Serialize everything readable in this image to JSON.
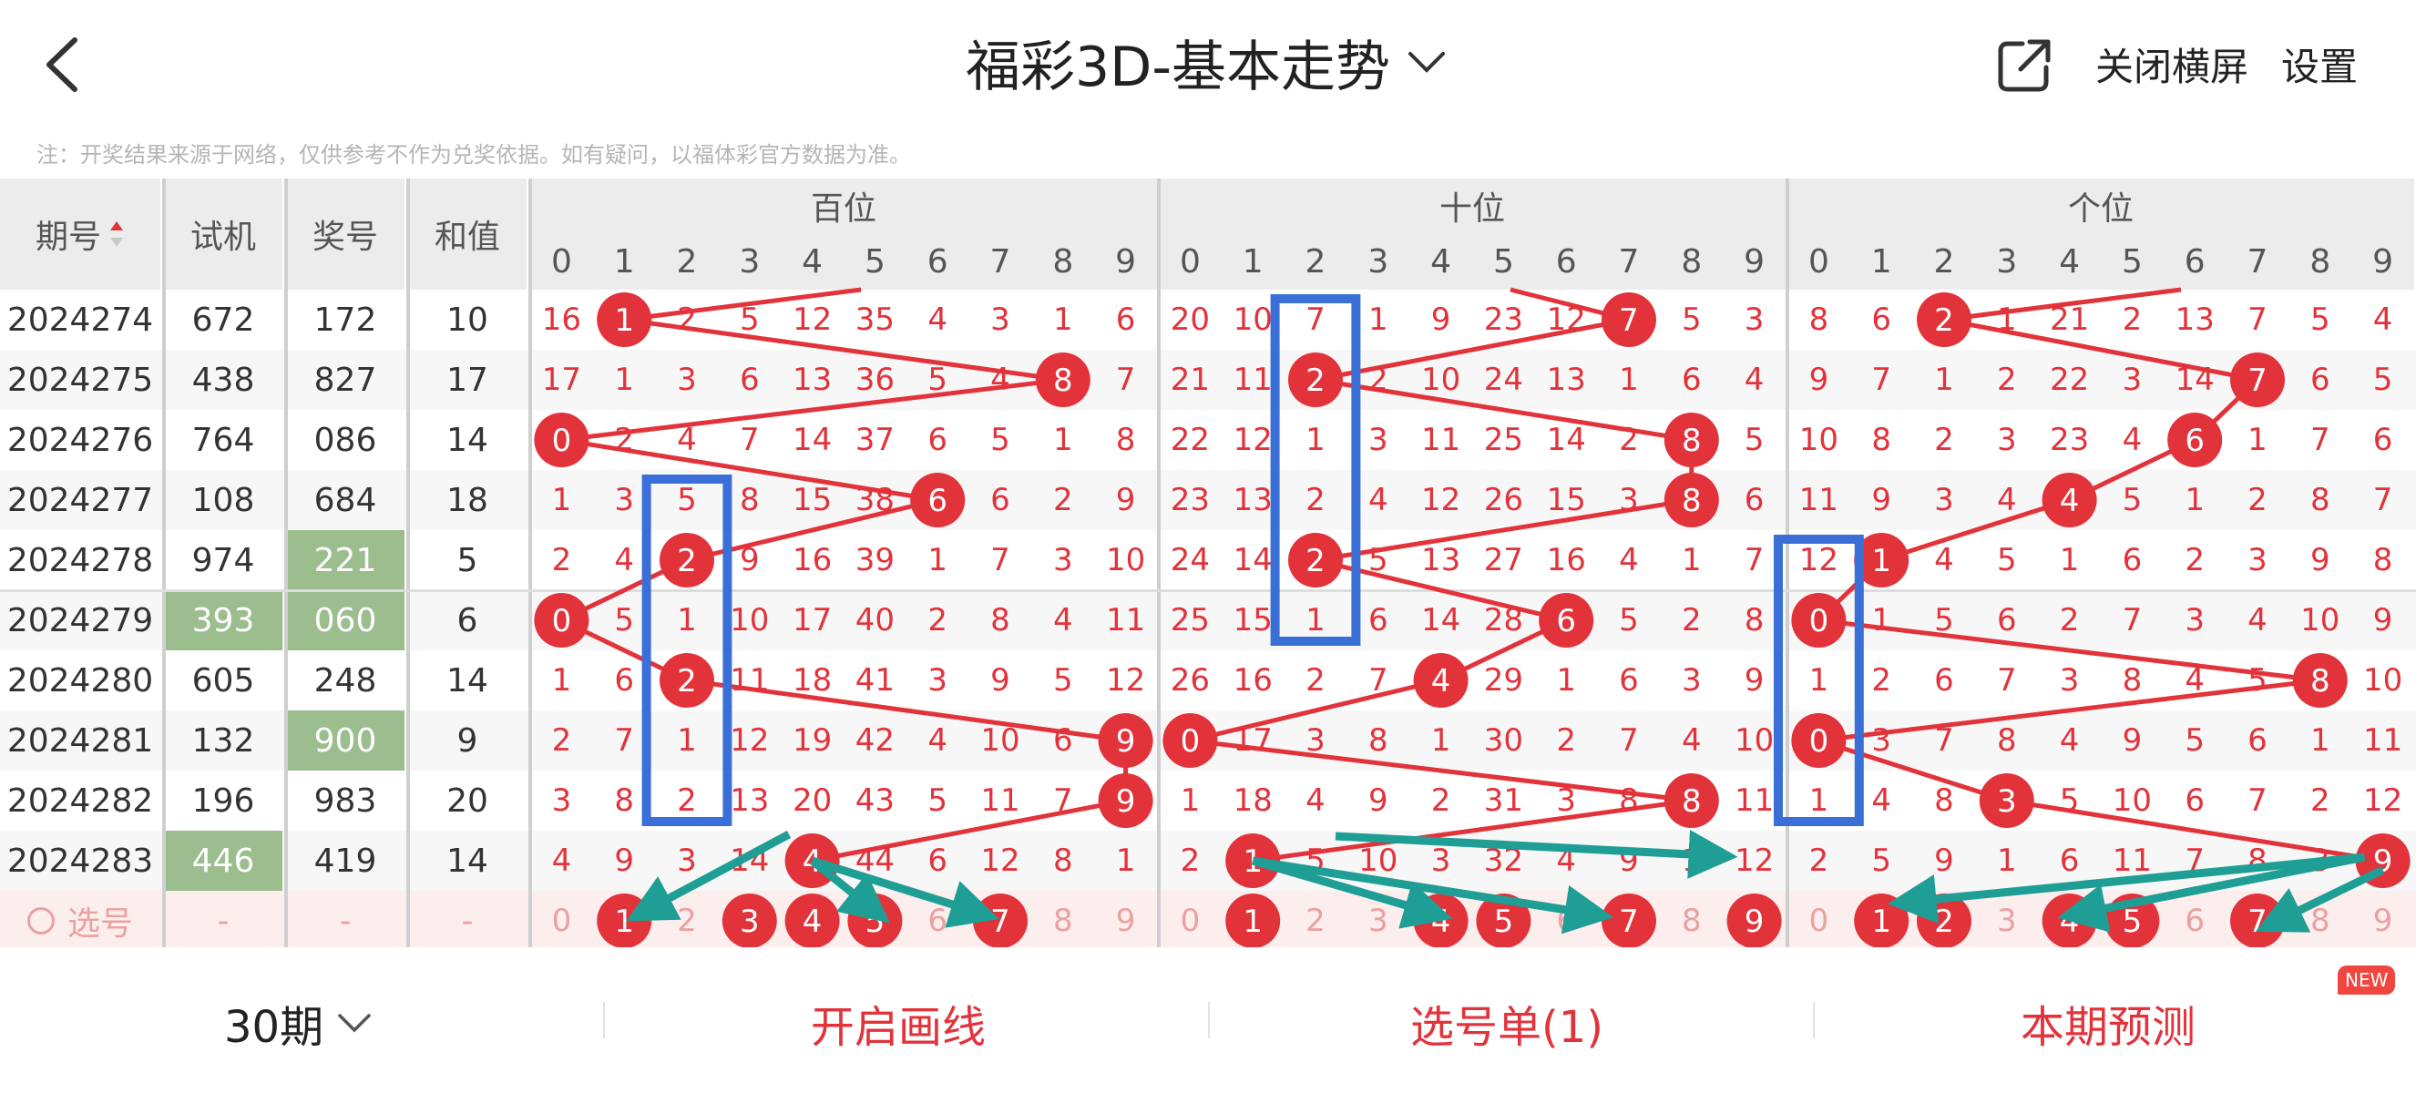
{
  "header": {
    "title": "福彩3D-基本走势",
    "close_landscape": "关闭横屏",
    "settings": "设置"
  },
  "notice": "注：开奖结果来源于网络，仅供参考不作为兑奖依据。如有疑问，以福体彩官方数据为准。",
  "table": {
    "col_issue": "期号",
    "col_trial": "试机",
    "col_prize": "奖号",
    "col_sum": "和值",
    "groups": [
      "百位",
      "十位",
      "个位"
    ],
    "digits": [
      "0",
      "1",
      "2",
      "3",
      "4",
      "5",
      "6",
      "7",
      "8",
      "9"
    ],
    "rows": [
      {
        "issue": "2024274",
        "trial": "672",
        "prize": "172",
        "sum": "10",
        "trial_hl": false,
        "prize_hl": false,
        "h": [
          "16",
          "1",
          "2",
          "5",
          "12",
          "35",
          "4",
          "3",
          "1",
          "6"
        ],
        "t": [
          "20",
          "10",
          "7",
          "1",
          "9",
          "23",
          "12",
          "7",
          "5",
          "3"
        ],
        "u": [
          "8",
          "6",
          "2",
          "1",
          "21",
          "2",
          "13",
          "7",
          "5",
          "4"
        ]
      },
      {
        "issue": "2024275",
        "trial": "438",
        "prize": "827",
        "sum": "17",
        "trial_hl": false,
        "prize_hl": false,
        "h": [
          "17",
          "1",
          "3",
          "6",
          "13",
          "36",
          "5",
          "4",
          "8",
          "7"
        ],
        "t": [
          "21",
          "11",
          "2",
          "2",
          "10",
          "24",
          "13",
          "1",
          "6",
          "4"
        ],
        "u": [
          "9",
          "7",
          "1",
          "2",
          "22",
          "3",
          "14",
          "7",
          "6",
          "5"
        ]
      },
      {
        "issue": "2024276",
        "trial": "764",
        "prize": "086",
        "sum": "14",
        "trial_hl": false,
        "prize_hl": false,
        "h": [
          "0",
          "2",
          "4",
          "7",
          "14",
          "37",
          "6",
          "5",
          "1",
          "8"
        ],
        "t": [
          "22",
          "12",
          "1",
          "3",
          "11",
          "25",
          "14",
          "2",
          "8",
          "5"
        ],
        "u": [
          "10",
          "8",
          "2",
          "3",
          "23",
          "4",
          "6",
          "1",
          "7",
          "6"
        ]
      },
      {
        "issue": "2024277",
        "trial": "108",
        "prize": "684",
        "sum": "18",
        "trial_hl": false,
        "prize_hl": false,
        "h": [
          "1",
          "3",
          "5",
          "8",
          "15",
          "38",
          "6",
          "6",
          "2",
          "9"
        ],
        "t": [
          "23",
          "13",
          "2",
          "4",
          "12",
          "26",
          "15",
          "3",
          "8",
          "6"
        ],
        "u": [
          "11",
          "9",
          "3",
          "4",
          "4",
          "5",
          "1",
          "2",
          "8",
          "7"
        ]
      },
      {
        "issue": "2024278",
        "trial": "974",
        "prize": "221",
        "sum": "5",
        "trial_hl": false,
        "prize_hl": true,
        "h": [
          "2",
          "4",
          "2",
          "9",
          "16",
          "39",
          "1",
          "7",
          "3",
          "10"
        ],
        "t": [
          "24",
          "14",
          "2",
          "5",
          "13",
          "27",
          "16",
          "4",
          "1",
          "7"
        ],
        "u": [
          "12",
          "1",
          "4",
          "5",
          "1",
          "6",
          "2",
          "3",
          "9",
          "8"
        ]
      },
      {
        "issue": "2024279",
        "trial": "393",
        "prize": "060",
        "sum": "6",
        "trial_hl": true,
        "prize_hl": true,
        "h": [
          "0",
          "5",
          "1",
          "10",
          "17",
          "40",
          "2",
          "8",
          "4",
          "11"
        ],
        "t": [
          "25",
          "15",
          "1",
          "6",
          "14",
          "28",
          "6",
          "5",
          "2",
          "8"
        ],
        "u": [
          "0",
          "1",
          "5",
          "6",
          "2",
          "7",
          "3",
          "4",
          "10",
          "9"
        ]
      },
      {
        "issue": "2024280",
        "trial": "605",
        "prize": "248",
        "sum": "14",
        "trial_hl": false,
        "prize_hl": false,
        "h": [
          "1",
          "6",
          "2",
          "11",
          "18",
          "41",
          "3",
          "9",
          "5",
          "12"
        ],
        "t": [
          "26",
          "16",
          "2",
          "7",
          "4",
          "29",
          "1",
          "6",
          "3",
          "9"
        ],
        "u": [
          "1",
          "2",
          "6",
          "7",
          "3",
          "8",
          "4",
          "5",
          "8",
          "10"
        ]
      },
      {
        "issue": "2024281",
        "trial": "132",
        "prize": "900",
        "sum": "9",
        "trial_hl": false,
        "prize_hl": true,
        "h": [
          "2",
          "7",
          "1",
          "12",
          "19",
          "42",
          "4",
          "10",
          "6",
          "9"
        ],
        "t": [
          "0",
          "17",
          "3",
          "8",
          "1",
          "30",
          "2",
          "7",
          "4",
          "10"
        ],
        "u": [
          "0",
          "3",
          "7",
          "8",
          "4",
          "9",
          "5",
          "6",
          "1",
          "11"
        ]
      },
      {
        "issue": "2024282",
        "trial": "196",
        "prize": "983",
        "sum": "20",
        "trial_hl": false,
        "prize_hl": false,
        "h": [
          "3",
          "8",
          "2",
          "13",
          "20",
          "43",
          "5",
          "11",
          "7",
          "9"
        ],
        "t": [
          "1",
          "18",
          "4",
          "9",
          "2",
          "31",
          "3",
          "8",
          "8",
          "11"
        ],
        "u": [
          "1",
          "4",
          "8",
          "3",
          "5",
          "10",
          "6",
          "7",
          "2",
          "12"
        ]
      },
      {
        "issue": "2024283",
        "trial": "446",
        "prize": "419",
        "sum": "14",
        "trial_hl": true,
        "prize_hl": false,
        "h": [
          "4",
          "9",
          "3",
          "14",
          "4",
          "44",
          "6",
          "12",
          "8",
          "1"
        ],
        "t": [
          "2",
          "1",
          "5",
          "10",
          "3",
          "32",
          "4",
          "9",
          "1",
          "12"
        ],
        "u": [
          "2",
          "5",
          "9",
          "1",
          "6",
          "11",
          "7",
          "8",
          "3",
          "9"
        ]
      }
    ],
    "winners": [
      [
        1,
        7,
        2
      ],
      [
        8,
        2,
        7
      ],
      [
        0,
        8,
        6
      ],
      [
        6,
        8,
        4
      ],
      [
        2,
        2,
        1
      ],
      [
        0,
        6,
        0
      ],
      [
        2,
        4,
        8
      ],
      [
        9,
        0,
        0
      ],
      [
        9,
        8,
        3
      ],
      [
        4,
        1,
        9
      ]
    ],
    "select_row": {
      "label": "选号",
      "trial": "-",
      "prize": "-",
      "sum": "-",
      "h": [
        "0",
        "1",
        "2",
        "3",
        "4",
        "5",
        "6",
        "7",
        "8",
        "9"
      ],
      "t": [
        "0",
        "1",
        "2",
        "3",
        "4",
        "5",
        "6",
        "7",
        "8",
        "9"
      ],
      "u": [
        "0",
        "1",
        "2",
        "3",
        "4",
        "5",
        "6",
        "7",
        "8",
        "9"
      ],
      "h_sel": [
        1,
        3,
        4,
        5,
        7
      ],
      "t_sel": [
        1,
        4,
        5,
        7,
        9
      ],
      "u_sel": [
        1,
        2,
        4,
        5,
        7
      ]
    }
  },
  "bottom": {
    "periods": "30期",
    "draw_lines": "开启画线",
    "pick_list": "选号单(1)",
    "predict": "本期预测",
    "new_badge": "NEW"
  },
  "colors": {
    "red": "#e2333b",
    "green_highlight": "#9cbd8e",
    "blue_box": "#3a6fd8",
    "teal_arrow": "#1e9e94",
    "header_gray": "#ececec"
  }
}
